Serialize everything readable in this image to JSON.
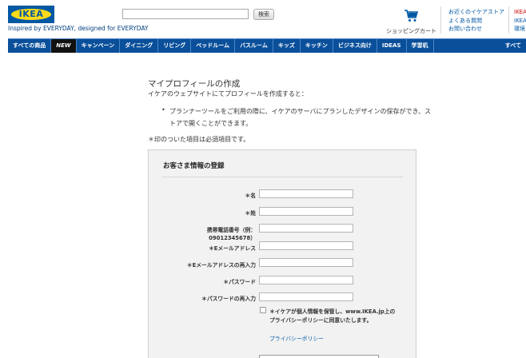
{
  "header": {
    "logo_text": "IKEA",
    "tagline": "Inspired by EVERYDAY, designed for EVERYDAY",
    "search": {
      "placeholder": "",
      "button_label": "検索"
    },
    "cart_label": "ショッピングカート",
    "links": [
      "お近くのイケアストア",
      "よくある質問",
      "お問い合わせ"
    ],
    "links_right": [
      "IKEA",
      "IKEA",
      "環境"
    ]
  },
  "nav": {
    "items": [
      "すべての商品",
      "NEW",
      "キャンペーン",
      "ダイニング",
      "リビング",
      "ベッドルーム",
      "バスルーム",
      "キッズ",
      "キッチン",
      "ビジネス向け",
      "IDEAS",
      "学習机"
    ],
    "right_item": "すべて"
  },
  "main": {
    "title": "マイプロフィールの作成",
    "intro": "イケアのウェブサイトにてプロフィールを作成すると：",
    "bullet": "プランナーツールをご利用の際に、イケアのサーバにプランしたデザインの保存ができ、ストアで開くことができます。",
    "required_note": "＊印のついた項目は必須項目です。"
  },
  "form": {
    "title": "お客さま情報の登録",
    "fields": {
      "first_name": "＊名",
      "last_name": "＊姓",
      "phone_line1": "携帯電話番号（例：",
      "phone_line2": "09012345678）",
      "email": "＊Eメールアドレス",
      "email_confirm": "＊Eメールアドレスの再入力",
      "password": "＊パスワード",
      "password_confirm": "＊パスワードの再入力"
    },
    "consent": "＊イケアが個人情報を保管し、www.IKEA.jp上のプライバシーポリシーに同意いたします。",
    "policy_link": "プライバシーポリシー"
  },
  "colors": {
    "brand_blue": "#0058a3",
    "brand_yellow": "#ffda1a",
    "nav_blue": "#0a4f9a"
  }
}
